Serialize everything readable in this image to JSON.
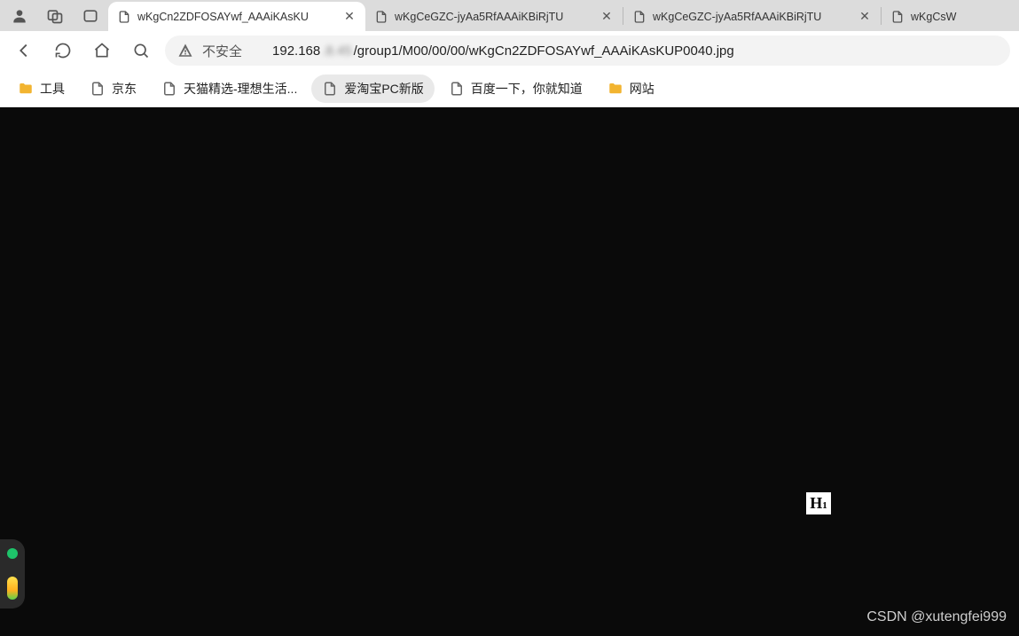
{
  "tabs": [
    {
      "title": "wKgCn2ZDFOSAYwf_AAAiKAsKU"
    },
    {
      "title": "wKgCeGZC-jyAa5RfAAAiKBiRjTU"
    },
    {
      "title": "wKgCeGZC-jyAa5RfAAAiKBiRjTU"
    },
    {
      "title": "wKgCsW"
    }
  ],
  "address": {
    "security_label": "不安全",
    "host_prefix": "192.168",
    "blurred": ".8.45",
    "path": "/group1/M00/00/00/wKgCn2ZDFOSAYwf_AAAiKAsKUP0040.jpg"
  },
  "bookmarks": [
    {
      "label": "工具",
      "type": "folder"
    },
    {
      "label": "京东",
      "type": "page"
    },
    {
      "label": "天猫精选-理想生活...",
      "type": "page"
    },
    {
      "label": "爱淘宝PC新版",
      "type": "page",
      "highlight": true
    },
    {
      "label": "百度一下，你就知道",
      "type": "page"
    },
    {
      "label": "网站",
      "type": "folder"
    }
  ],
  "badge": {
    "main": "H",
    "sub": "1"
  },
  "watermark": "CSDN @xutengfei999"
}
